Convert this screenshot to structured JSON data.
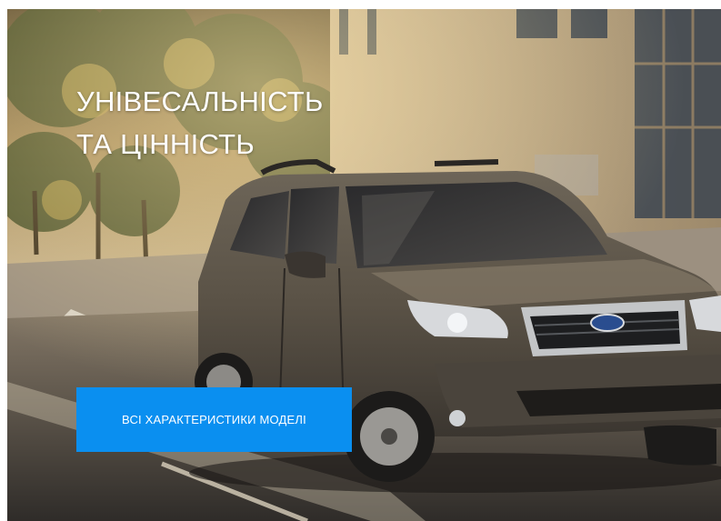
{
  "hero": {
    "headline_line1": "УНІВЕСАЛЬНІСТЬ",
    "headline_line2": "ТА ЦІННІСТЬ",
    "cta_label": "ВСІ ХАРАКТЕРИСТИКИ МОДЕЛІ",
    "image": "suv-on-city-street-photo"
  },
  "colors": {
    "cta_background": "#0a8ff0",
    "headline_text": "#ffffff"
  }
}
